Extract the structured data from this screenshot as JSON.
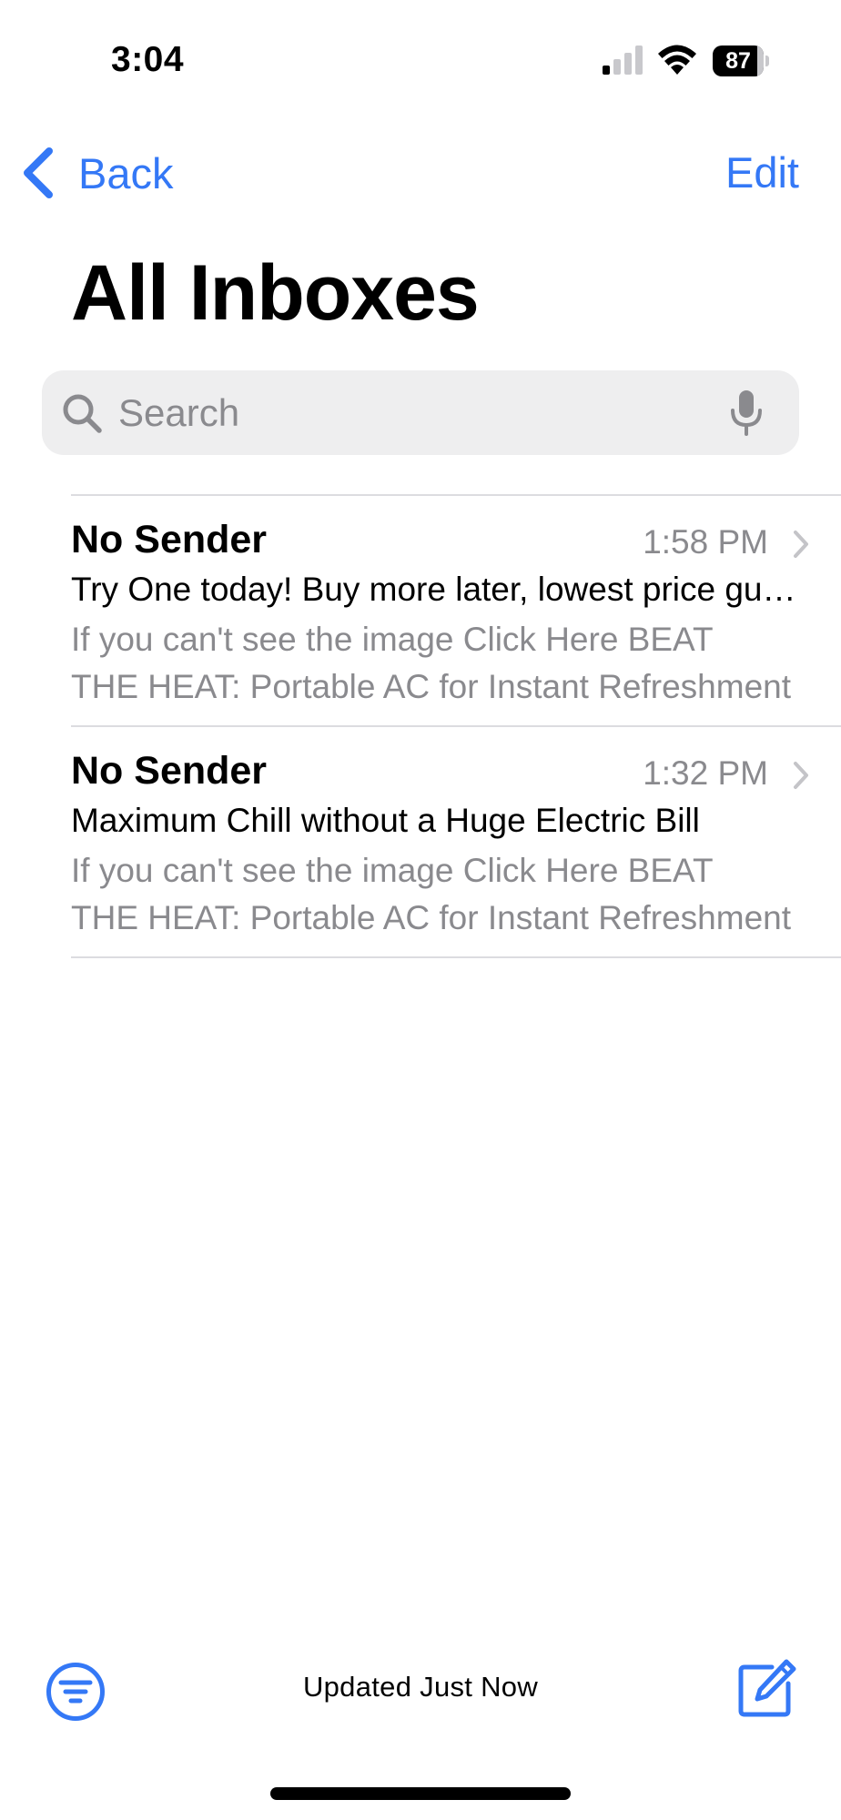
{
  "status_bar": {
    "time": "3:04",
    "battery": "87",
    "battery_level": 0.87,
    "icons": [
      "cellular-signal-icon",
      "wifi-icon",
      "battery-icon"
    ]
  },
  "nav": {
    "back_label": "Back",
    "edit_label": "Edit"
  },
  "page_title": "All Inboxes",
  "search": {
    "placeholder": "Search"
  },
  "mails": [
    {
      "sender": "No Sender",
      "time": "1:58 PM",
      "subject": "Try One today! Buy more later, lowest price guaranteed",
      "preview_line1": "If you can't see the image Click Here BEAT",
      "preview_line2": "THE HEAT: Portable AC for Instant Refreshment"
    },
    {
      "sender": "No Sender",
      "time": "1:32 PM",
      "subject": "Maximum Chill without a Huge Electric Bill",
      "preview_line1": "If you can't see the image Click Here BEAT",
      "preview_line2": "THE HEAT: Portable AC for Instant Refreshment"
    }
  ],
  "toolbar": {
    "status": "Updated Just Now",
    "filter_icon": "filter-icon",
    "compose_icon": "compose-icon"
  },
  "colors": {
    "accent": "#3478f6",
    "secondary_text": "#8a8a8e",
    "separator": "#dcdce0",
    "search_bg": "#eeeeef"
  }
}
